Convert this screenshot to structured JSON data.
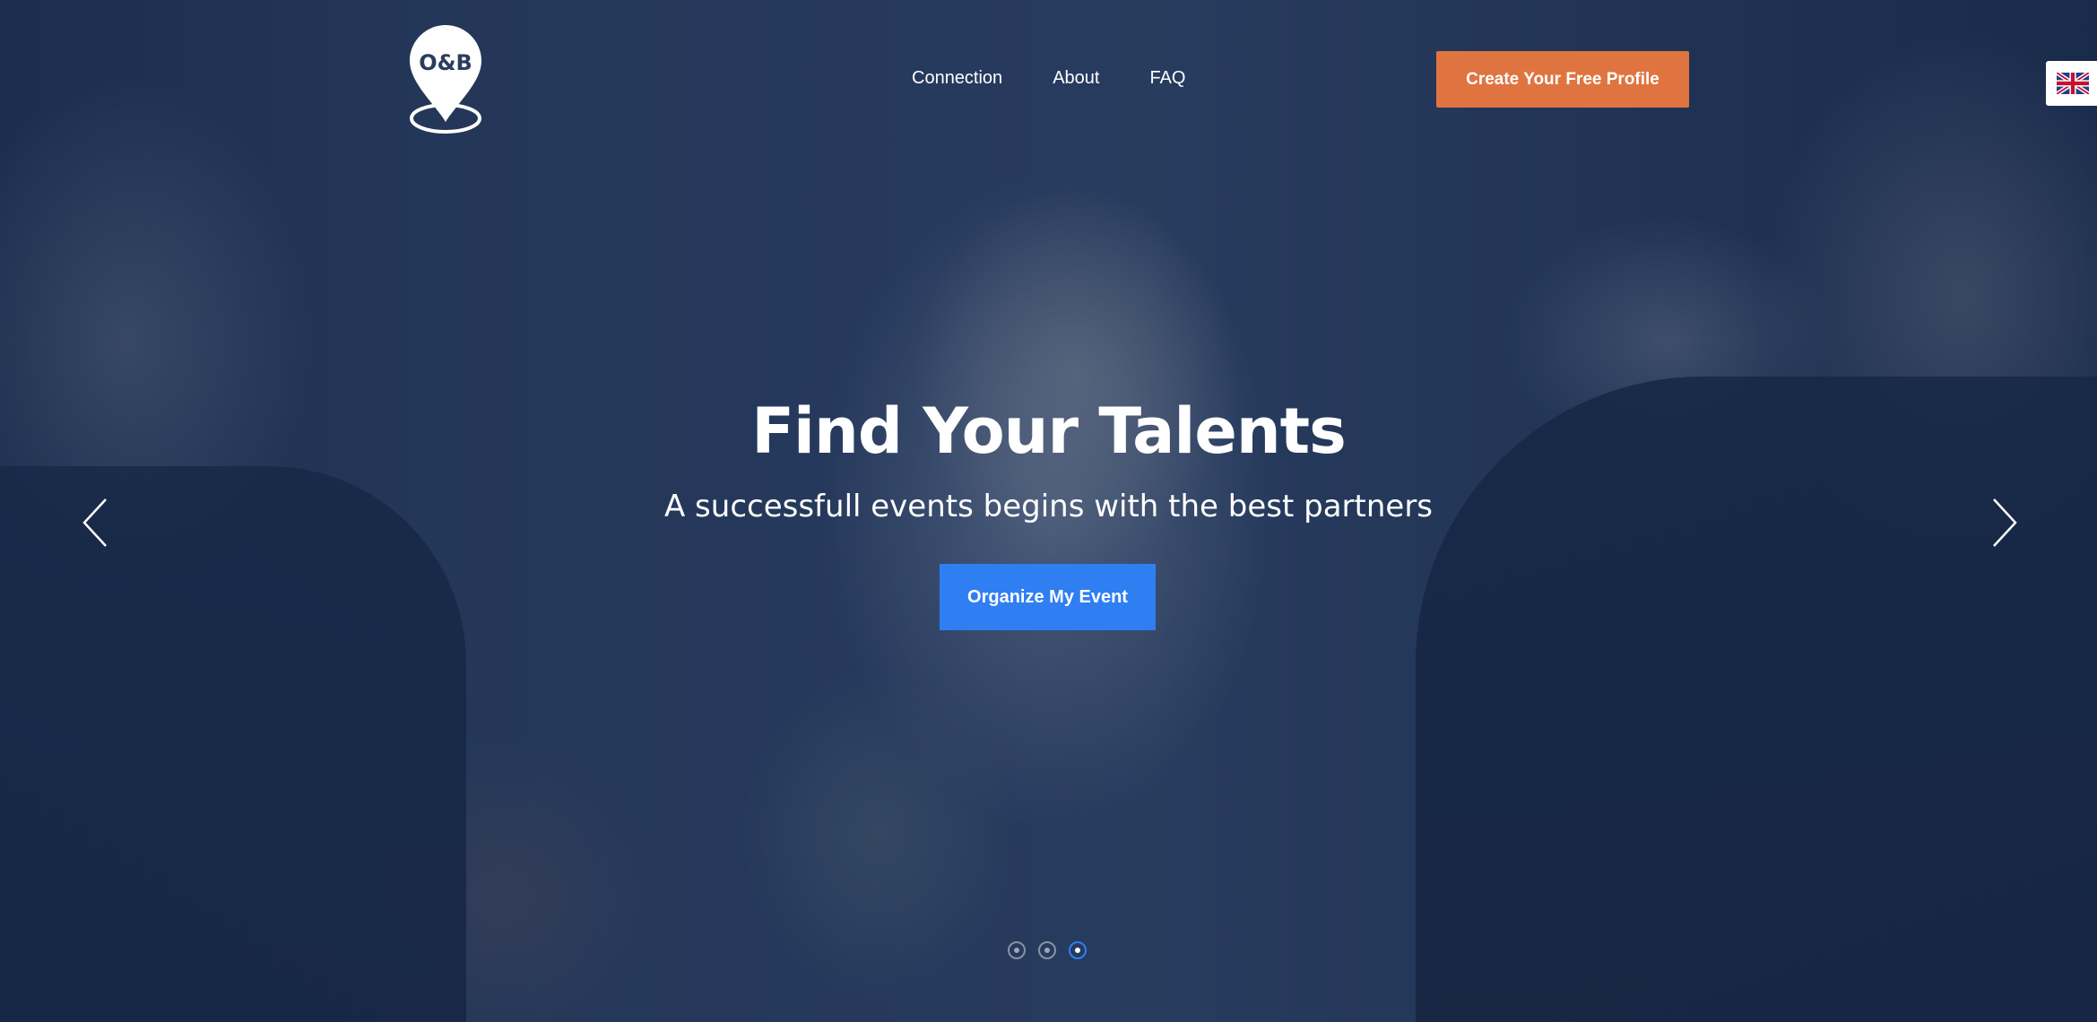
{
  "brand": {
    "logo_text": "O&B"
  },
  "nav": {
    "items": [
      {
        "label": "Connection"
      },
      {
        "label": "About"
      },
      {
        "label": "FAQ"
      }
    ]
  },
  "header": {
    "cta_label": "Create Your Free Profile",
    "language_flag": "uk-flag-icon"
  },
  "hero": {
    "title": "Find Your Talents",
    "subtitle": "A successfull events begins with the best partners",
    "cta_label": "Organize My Event"
  },
  "carousel": {
    "slide_count": 3,
    "active_index": 3,
    "prev_icon": "chevron-left-icon",
    "next_icon": "chevron-right-icon"
  },
  "colors": {
    "accent_orange": "#e07440",
    "accent_blue": "#2f7ff3",
    "overlay": "#162646"
  }
}
